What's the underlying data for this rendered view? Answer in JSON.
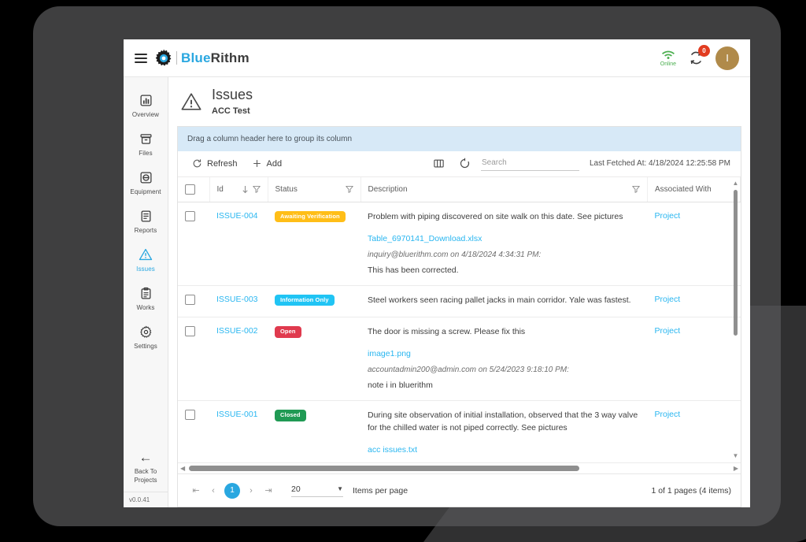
{
  "topbar": {
    "menu_icon": "hamburger-icon",
    "logo_icon": "gear-icon",
    "brand_first": "Blue",
    "brand_second": "Rithm",
    "wifi_icon": "wifi-icon",
    "online_label": "Online",
    "sync_icon": "sync-icon",
    "sync_badge_count": "0",
    "avatar_initial": "I",
    "accent_color": "#29a7e0",
    "badge_color": "#e23c20",
    "avatar_color": "#b08a4a",
    "online_color": "#4caf50"
  },
  "sidebar": {
    "items": [
      {
        "label": "Overview",
        "icon": "chart-bar-icon",
        "active": false
      },
      {
        "label": "Files",
        "icon": "archive-icon",
        "active": false
      },
      {
        "label": "Equipment",
        "icon": "equipment-icon",
        "active": false
      },
      {
        "label": "Reports",
        "icon": "document-icon",
        "active": false
      },
      {
        "label": "Issues",
        "icon": "warning-icon",
        "active": true
      },
      {
        "label": "Works",
        "icon": "clipboard-icon",
        "active": false
      },
      {
        "label": "Settings",
        "icon": "gear-icon",
        "active": false
      }
    ],
    "back_label": "Back To\nProjects",
    "back_label_line1": "Back To",
    "back_label_line2": "Projects",
    "back_icon": "arrow-left-icon",
    "version": "v0.0.41"
  },
  "page": {
    "icon": "warning-triangle-icon",
    "title": "Issues",
    "subtitle": "ACC Test"
  },
  "grid": {
    "group_bar_text": "Drag a column header here to group its column",
    "toolbar": {
      "refresh_label": "Refresh",
      "refresh_icon": "refresh-icon",
      "add_label": "Add",
      "add_icon": "plus-icon",
      "columns_icon": "column-chooser-icon",
      "reset_icon": "reset-icon",
      "search_placeholder": "Search",
      "search_value": "",
      "last_fetched": "Last Fetched At: 4/18/2024 12:25:58 PM"
    },
    "columns": [
      {
        "label": "",
        "icons": []
      },
      {
        "label": "Id",
        "icons": [
          "sort-down-icon",
          "filter-icon"
        ]
      },
      {
        "label": "Status",
        "icons": [
          "filter-icon"
        ]
      },
      {
        "label": "Description",
        "icons": [
          "filter-icon"
        ]
      },
      {
        "label": "Associated With",
        "icons": []
      }
    ],
    "rows": [
      {
        "id": "ISSUE-004",
        "status": "Awaiting Verification",
        "status_color": "#ffbe18",
        "description": "Problem with piping discovered on site walk on this date. See pictures",
        "attachment": "Table_6970141_Download.xlsx",
        "comment_author": "inquiry@bluerithm.com on 4/18/2024 4:34:31 PM:",
        "comment_text": "This has been corrected.",
        "associated_with": "Project"
      },
      {
        "id": "ISSUE-003",
        "status": "Information Only",
        "status_color": "#20c4f4",
        "description": "Steel workers seen racing pallet jacks in main corridor. Yale was fastest.",
        "attachment": "",
        "comment_author": "",
        "comment_text": "",
        "associated_with": "Project"
      },
      {
        "id": "ISSUE-002",
        "status": "Open",
        "status_color": "#e03a4e",
        "description": "The door is missing a screw. Please fix this",
        "attachment": "image1.png",
        "comment_author": "accountadmin200@admin.com on 5/24/2023 9:18:10 PM:",
        "comment_text": "note i in bluerithm",
        "associated_with": "Project"
      },
      {
        "id": "ISSUE-001",
        "status": "Closed",
        "status_color": "#209a54",
        "description": "During site observation of initial installation, observed that the 3 way valve for the chilled water is not piped correctly. See pictures",
        "attachment": "acc issues.txt",
        "comment_author": "",
        "comment_text": "",
        "associated_with": "Project"
      }
    ]
  },
  "pager": {
    "first_icon": "page-first-icon",
    "prev_icon": "page-prev-icon",
    "current_page": "1",
    "next_icon": "page-next-icon",
    "last_icon": "page-last-icon",
    "page_size": "20",
    "items_per_page_label": "Items per page",
    "summary": "1 of 1 pages (4 items)"
  }
}
